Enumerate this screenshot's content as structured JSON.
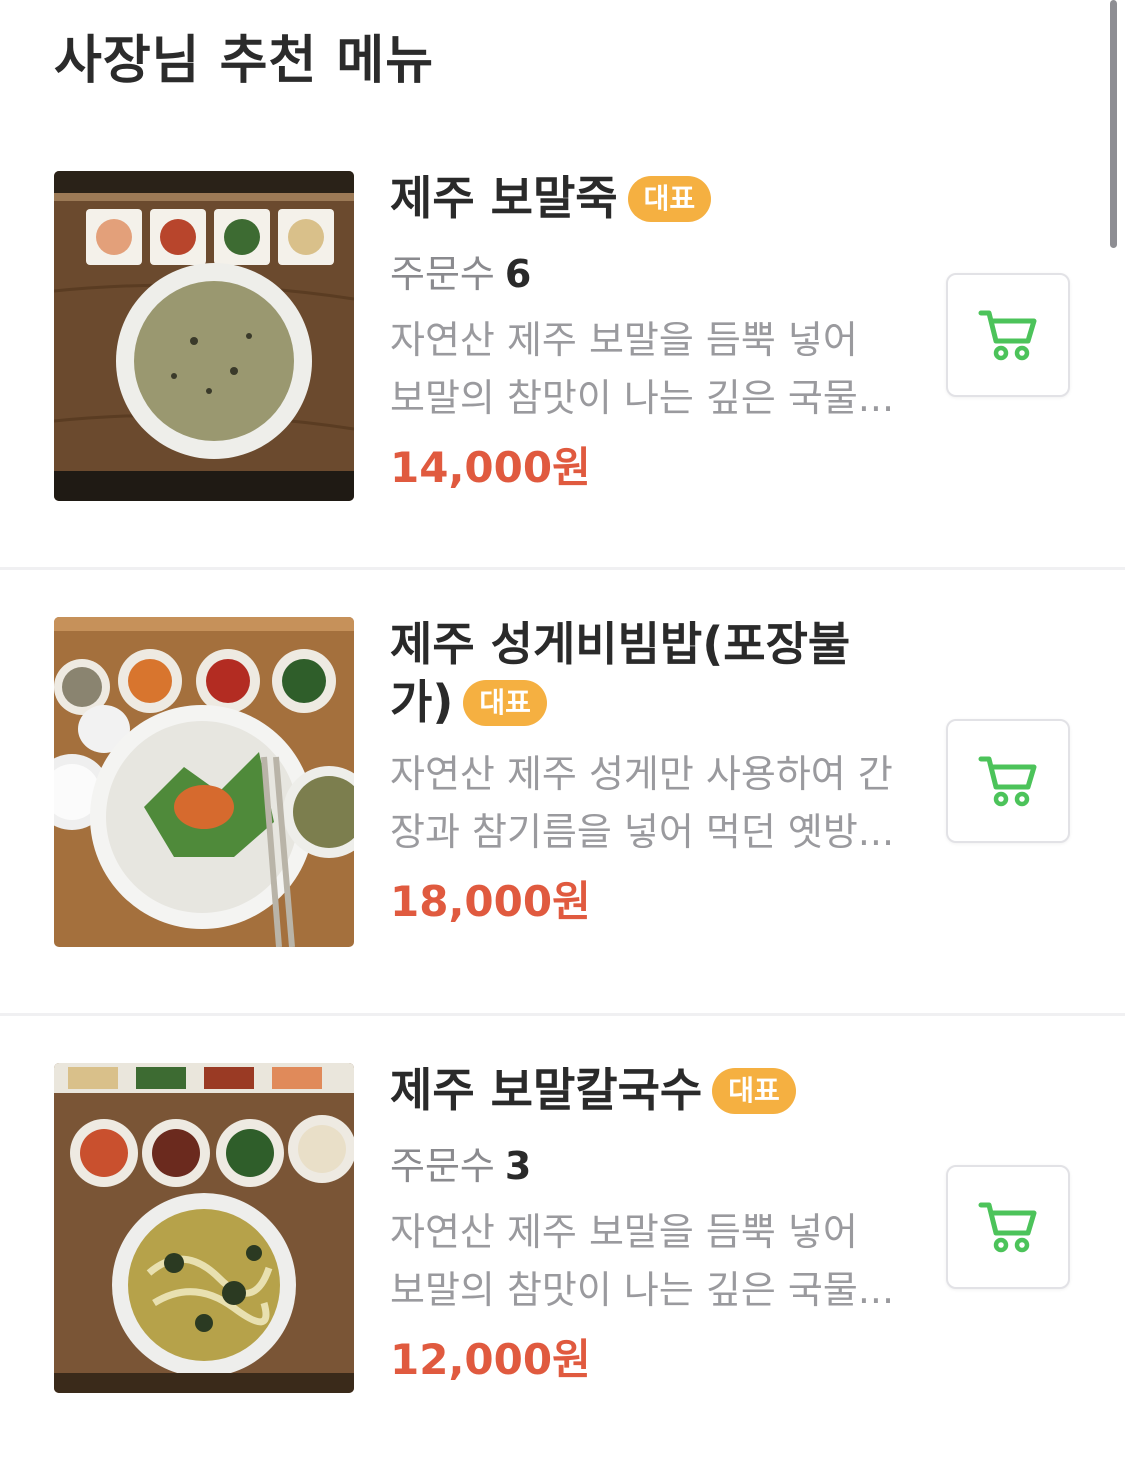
{
  "section": {
    "title": "사장님 추천 메뉴"
  },
  "colors": {
    "badge": "#f5b041",
    "price": "#e05a3f",
    "cart_icon": "#4cc35a"
  },
  "menu": [
    {
      "name": "제주 보말죽",
      "badge": "대표",
      "orders_label": "주문수",
      "orders_count": "6",
      "description": "자연산 제주 보말을 듬뿍 넣어 보말의 참맛이 나는 깊은 국물...",
      "price": "14,000원",
      "cart_icon": "cart-icon"
    },
    {
      "name_line1": "제주 성게비빔밥(포장불",
      "name_line2": "가)",
      "badge": "대표",
      "description": "자연산 제주 성게만 사용하여 간장과 참기름을 넣어 먹던 옛방...",
      "price": "18,000원",
      "cart_icon": "cart-icon"
    },
    {
      "name": "제주 보말칼국수",
      "badge": "대표",
      "orders_label": "주문수",
      "orders_count": "3",
      "description": "자연산 제주 보말을 듬뿍 넣어 보말의 참맛이 나는 깊은 국물...",
      "price": "12,000원",
      "cart_icon": "cart-icon"
    }
  ]
}
